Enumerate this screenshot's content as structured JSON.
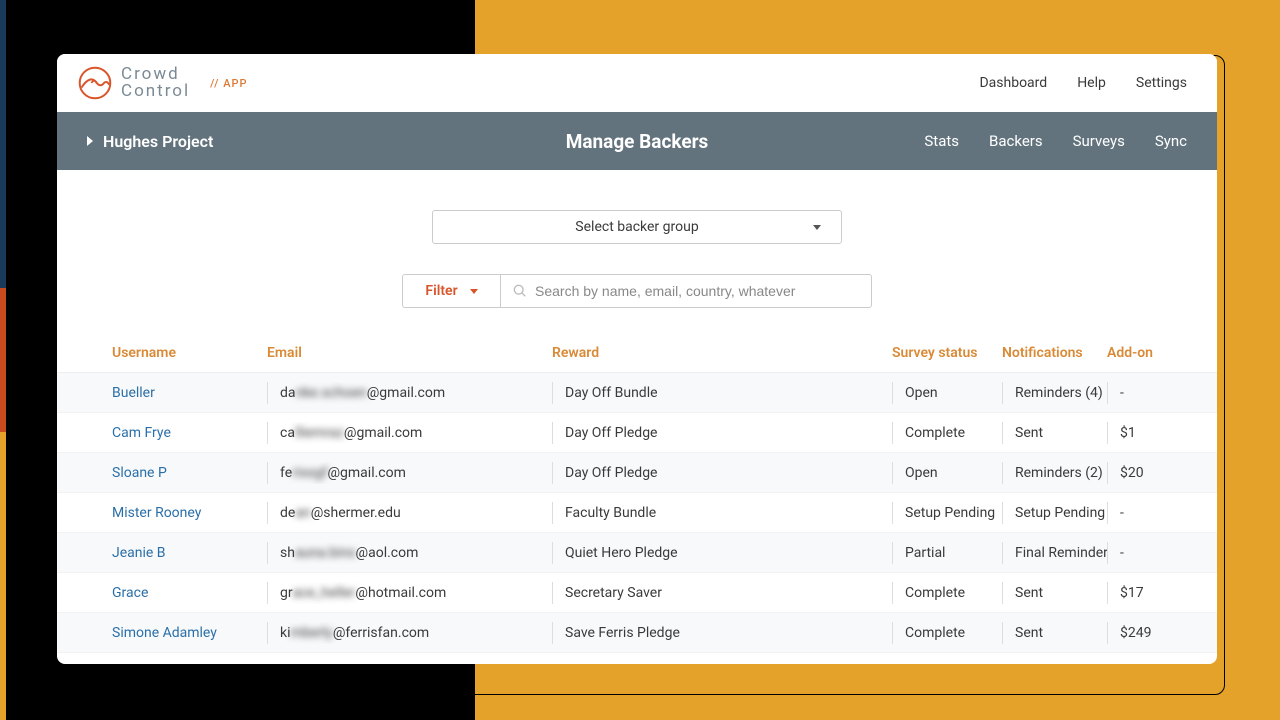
{
  "brand": {
    "line1": "Crowd",
    "line2": "Control",
    "suffix": "// APP"
  },
  "top_nav": {
    "dashboard": "Dashboard",
    "help": "Help",
    "settings": "Settings"
  },
  "sub_header": {
    "project": "Hughes Project",
    "title": "Manage Backers",
    "nav": {
      "stats": "Stats",
      "backers": "Backers",
      "surveys": "Surveys",
      "sync": "Sync"
    }
  },
  "controls": {
    "group_select_label": "Select backer group",
    "filter_label": "Filter",
    "search_placeholder": "Search by name, email, country, whatever"
  },
  "table": {
    "headers": {
      "username": "Username",
      "email": "Email",
      "reward": "Reward",
      "survey_status": "Survey status",
      "notifications": "Notifications",
      "addon": "Add-on"
    },
    "rows": [
      {
        "username": "Bueller",
        "email_pre": "da",
        "email_blur": "nke.schoen",
        "email_post": "@gmail.com",
        "reward": "Day Off Bundle",
        "survey": "Open",
        "notif": "Reminders (4)",
        "addon": "-"
      },
      {
        "username": "Cam Frye",
        "email_pre": "ca",
        "email_blur": "lliemraz",
        "email_post": "@gmail.com",
        "reward": "Day Off Pledge",
        "survey": "Complete",
        "notif": "Sent",
        "addon": "$1"
      },
      {
        "username": "Sloane P",
        "email_pre": "fe",
        "email_blur": "rissgf",
        "email_post": "@gmail.com",
        "reward": "Day Off Pledge",
        "survey": "Open",
        "notif": "Reminders (2)",
        "addon": "$20"
      },
      {
        "username": "Mister Rooney",
        "email_pre": "de",
        "email_blur": "an",
        "email_post": "@shermer.edu",
        "reward": "Faculty Bundle",
        "survey": "Setup Pending",
        "notif": "Setup Pending",
        "addon": "-"
      },
      {
        "username": "Jeanie B",
        "email_pre": "sh",
        "email_blur": "auna.bins",
        "email_post": "@aol.com",
        "reward": "Quiet Hero Pledge",
        "survey": "Partial",
        "notif": "Final Reminder",
        "addon": "-"
      },
      {
        "username": "Grace",
        "email_pre": "gr",
        "email_blur": "ace_heller",
        "email_post": "@hotmail.com",
        "reward": "Secretary Saver",
        "survey": "Complete",
        "notif": "Sent",
        "addon": "$17"
      },
      {
        "username": "Simone Adamley",
        "email_pre": "ki",
        "email_blur": "mberly",
        "email_post": "@ferrisfan.com",
        "reward": "Save Ferris Pledge",
        "survey": "Complete",
        "notif": "Sent",
        "addon": "$249"
      }
    ]
  }
}
